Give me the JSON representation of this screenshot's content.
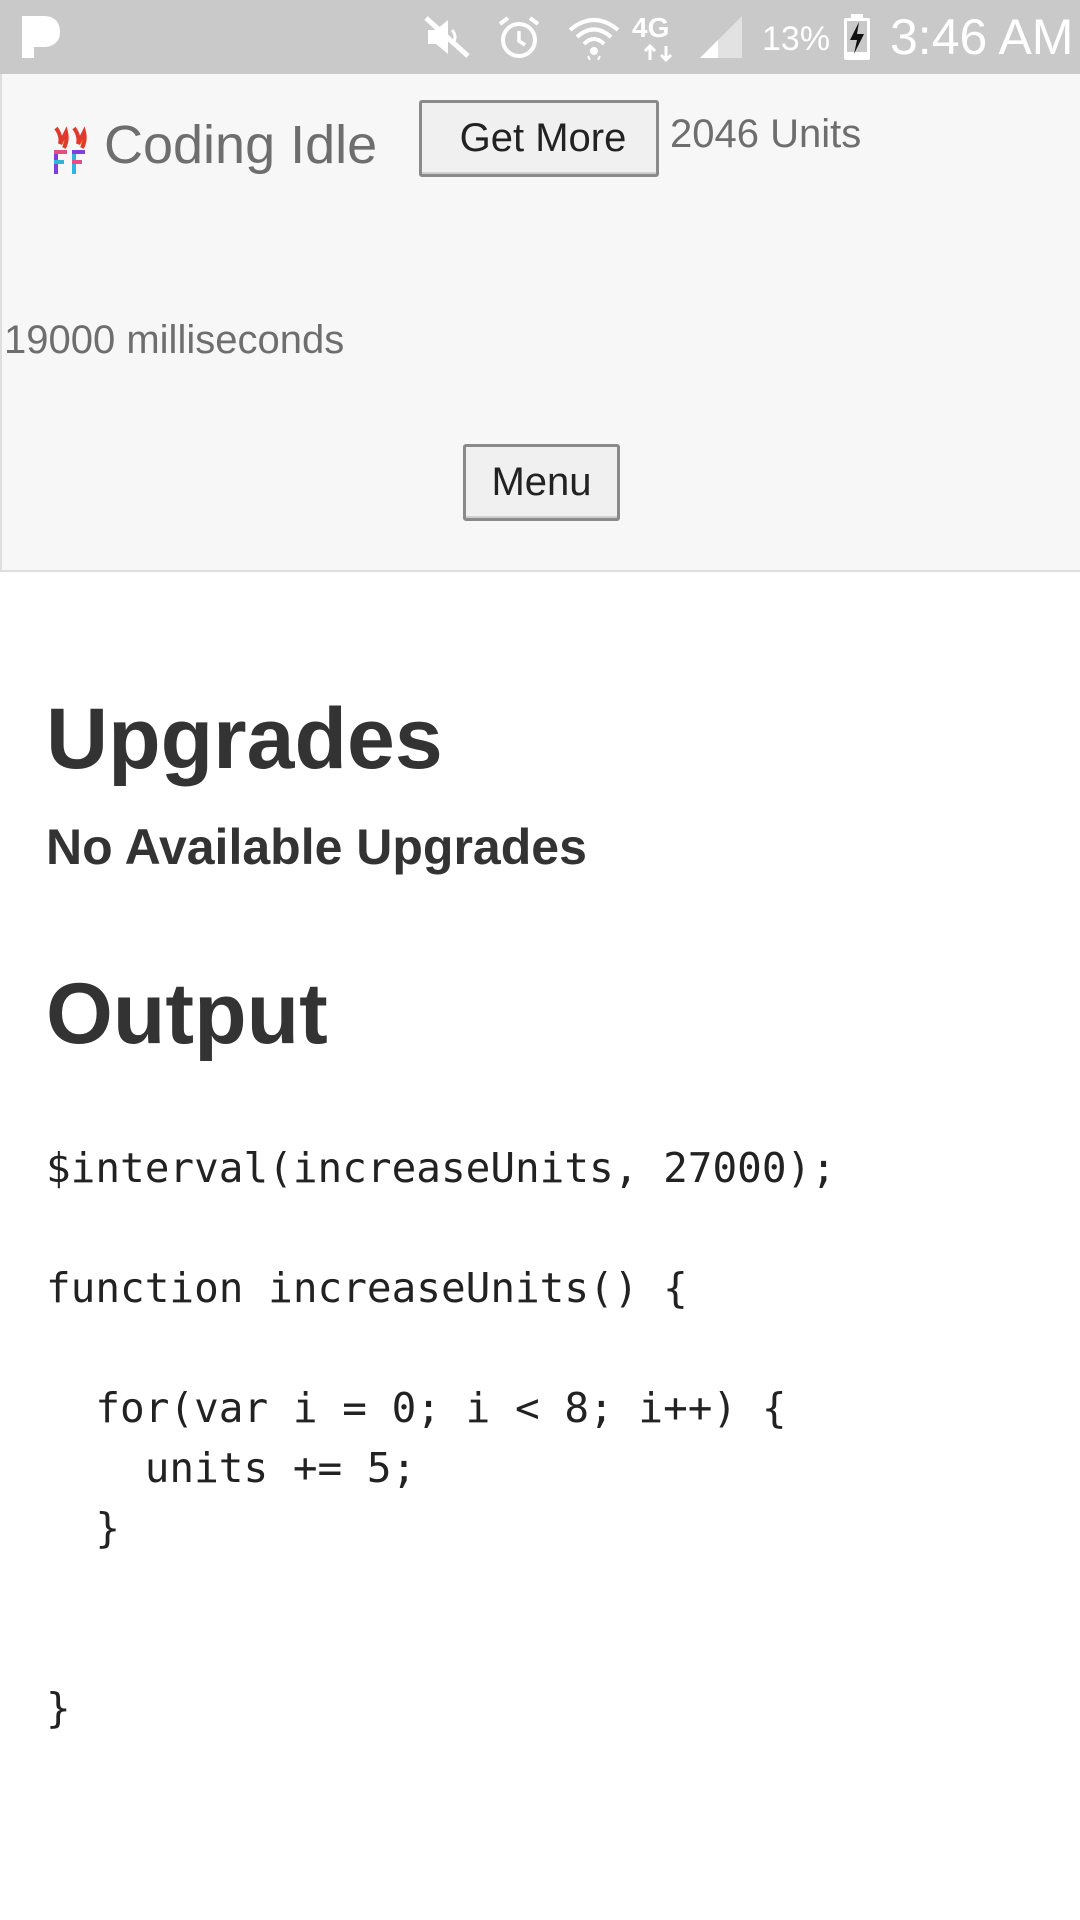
{
  "status_bar": {
    "battery_percent": "13%",
    "time": "3:46 AM",
    "network": "4G",
    "icons": [
      "pandora-icon",
      "mute-icon",
      "alarm-icon",
      "wifi-icon",
      "4g-icon",
      "signal-icon",
      "battery-charging-icon"
    ]
  },
  "header": {
    "app_title": "Coding Idle",
    "get_more_label": "Get More",
    "units_text": "2046 Units",
    "timer_text": "19000 milliseconds",
    "menu_label": "Menu"
  },
  "upgrades": {
    "heading": "Upgrades",
    "empty_text": "No Available Upgrades"
  },
  "output": {
    "heading": "Output",
    "code": "$interval(increaseUnits, 27000);\n\nfunction increaseUnits() {\n\n  for(var i = 0; i < 8; i++) {\n    units += 5;\n  }\n\n\n}"
  },
  "colors": {
    "status_bar_bg": "#c9c9c9",
    "panel_bg": "#f7f7f7",
    "heading_text": "#333333",
    "muted_text": "#6e6e6e"
  }
}
